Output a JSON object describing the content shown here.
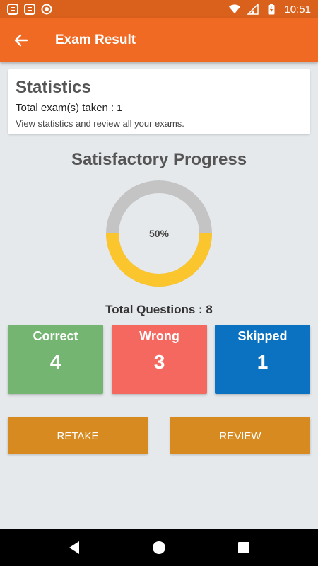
{
  "status_bar": {
    "time": "10:51",
    "left_icons": [
      "app-notification-icon",
      "app-notification-icon",
      "circle-notification-icon"
    ],
    "right_icons": [
      "wifi-icon",
      "signal-icon",
      "battery-icon"
    ]
  },
  "app_bar": {
    "title": "Exam Result",
    "back_icon": "arrow-back-icon"
  },
  "statistics": {
    "title": "Statistics",
    "total_label": "Total exam(s) taken : ",
    "total_value": "1",
    "description": "View statistics and review all your exams."
  },
  "progress": {
    "title": "Satisfactory Progress",
    "percent_label": "50%",
    "percent": 50,
    "colors": {
      "filled": "#fbc52d",
      "remaining": "#c4c4c4"
    }
  },
  "total_questions": "Total Questions : 8",
  "results": {
    "correct": {
      "label": "Correct",
      "value": "4",
      "color": "#74b572"
    },
    "wrong": {
      "label": "Wrong",
      "value": "3",
      "color": "#f46860"
    },
    "skipped": {
      "label": "Skipped",
      "value": "1",
      "color": "#0a72c0"
    }
  },
  "actions": {
    "retake_label": "RETAKE",
    "review_label": "REVIEW",
    "color": "#d68a1f"
  },
  "colors": {
    "app_bar": "#f06a24",
    "status_bar": "#d9611c",
    "background": "#e6e9ec"
  }
}
